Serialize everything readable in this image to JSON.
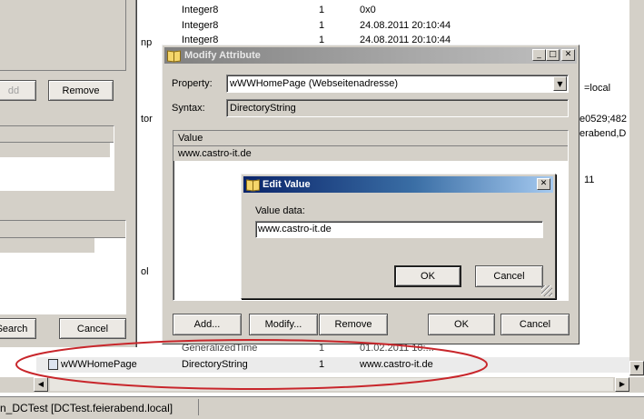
{
  "background_table": {
    "rows_top": [
      {
        "type": "Integer8",
        "count": "1",
        "value": "0x0"
      },
      {
        "type": "Integer8",
        "count": "1",
        "value": "24.08.2011 20:10:44"
      },
      {
        "type": "Integer8",
        "count": "1",
        "value": "24.08.2011 20:10:44"
      }
    ],
    "left_fragments": [
      "np",
      "tor",
      "ol"
    ],
    "right_fragments": [
      "=local",
      "e0529;482",
      "erabend,D",
      "11"
    ],
    "partial_row": {
      "name": "...",
      "type": "GeneralizedTime",
      "count": "1",
      "value": "01.02.2011 10:..."
    },
    "highlighted_row": {
      "name": "wWWHomePage",
      "type": "DirectoryString",
      "count": "1",
      "value": "www.castro-it.de"
    }
  },
  "left_window": {
    "add_label": "dd",
    "remove_label": "Remove",
    "search_label": "Search",
    "cancel_label": "Cancel"
  },
  "status_bar": {
    "text": "n_DCTest [DCTest.feierabend.local]"
  },
  "modify_dialog": {
    "title": "Modify Attribute",
    "property_label": "Property:",
    "property_value": "wWWHomePage (Webseitenadresse)",
    "syntax_label": "Syntax:",
    "syntax_value": "DirectoryString",
    "list_header": "Value",
    "list_values": [
      "www.castro-it.de"
    ],
    "buttons": {
      "add": "Add...",
      "modify": "Modify...",
      "remove": "Remove",
      "ok": "OK",
      "cancel": "Cancel"
    },
    "controls": {
      "minimize": "_",
      "maximize": "□",
      "close": "✕"
    }
  },
  "edit_dialog": {
    "title": "Edit Value",
    "value_label": "Value data:",
    "value_input": "www.castro-it.de",
    "ok": "OK",
    "cancel": "Cancel",
    "close": "✕"
  },
  "colors": {
    "dialog_gray": "#d4d0c8",
    "title_active": "#0a246a",
    "annotation_red": "#c8262b"
  }
}
